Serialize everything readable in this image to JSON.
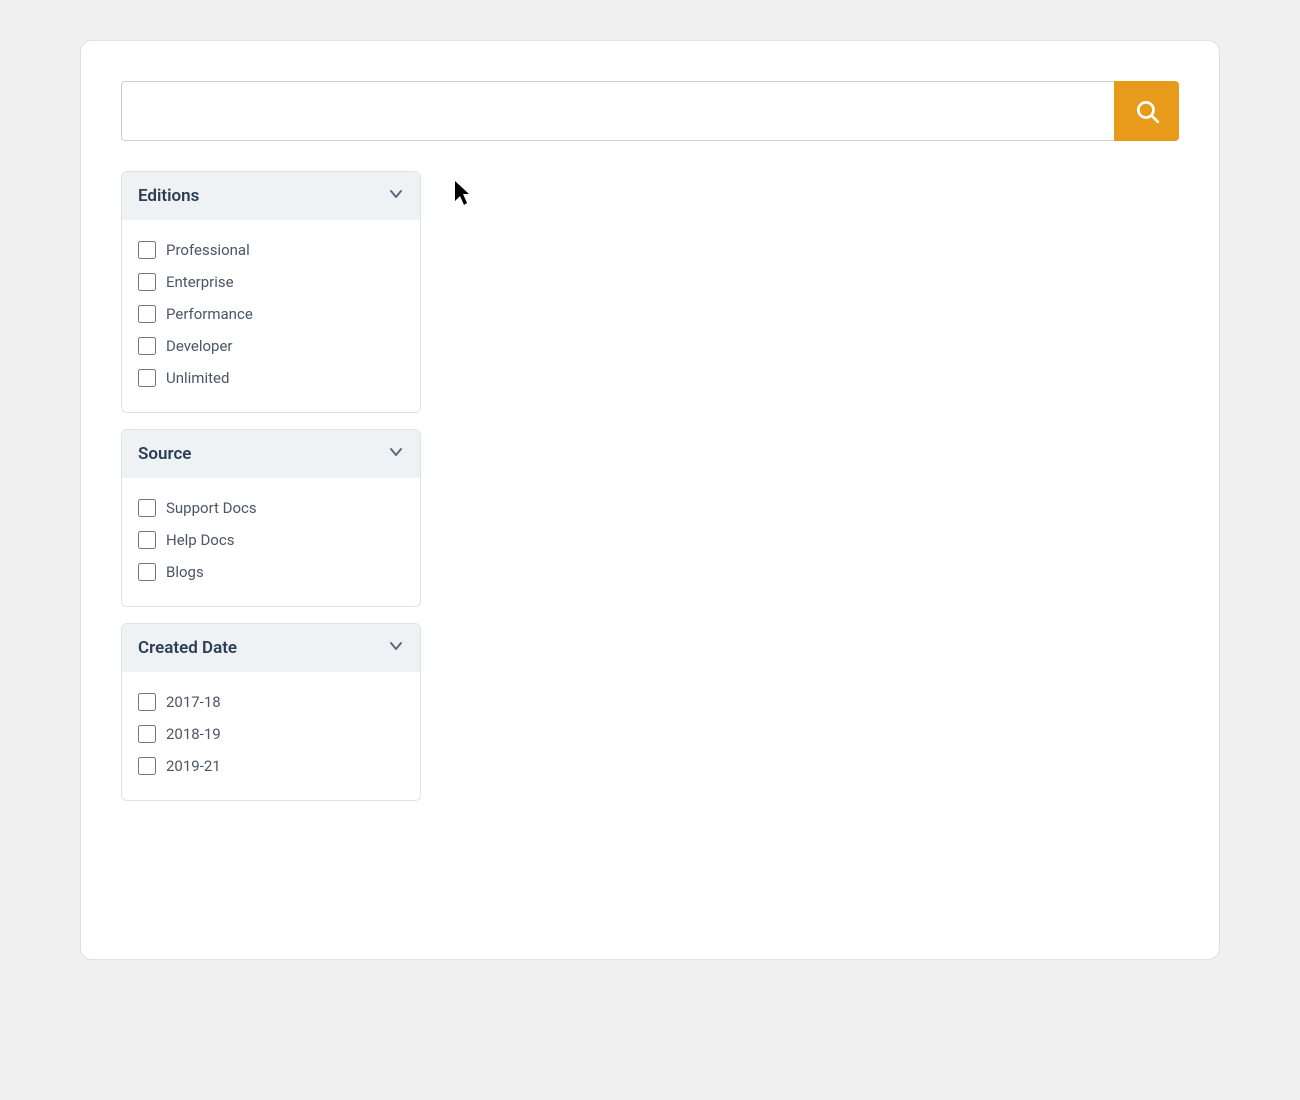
{
  "search": {
    "placeholder": "",
    "button_label": "Search"
  },
  "editions_filter": {
    "title": "Editions",
    "items": [
      {
        "label": "Professional",
        "checked": false
      },
      {
        "label": "Enterprise",
        "checked": false
      },
      {
        "label": "Performance",
        "checked": false
      },
      {
        "label": "Developer",
        "checked": false
      },
      {
        "label": "Unlimited",
        "checked": false
      }
    ]
  },
  "source_filter": {
    "title": "Source",
    "items": [
      {
        "label": "Support Docs",
        "checked": false
      },
      {
        "label": "Help Docs",
        "checked": false
      },
      {
        "label": "Blogs",
        "checked": false
      }
    ]
  },
  "created_date_filter": {
    "title": "Created Date",
    "items": [
      {
        "label": "2017-18",
        "checked": false
      },
      {
        "label": "2018-19",
        "checked": false
      },
      {
        "label": "2019-21",
        "checked": false
      }
    ]
  },
  "icons": {
    "search": "search-icon",
    "chevron_down": "chevron-down-icon"
  },
  "colors": {
    "search_button_bg": "#e89a1a",
    "filter_header_bg": "#eef2f5",
    "accent": "#e89a1a"
  }
}
